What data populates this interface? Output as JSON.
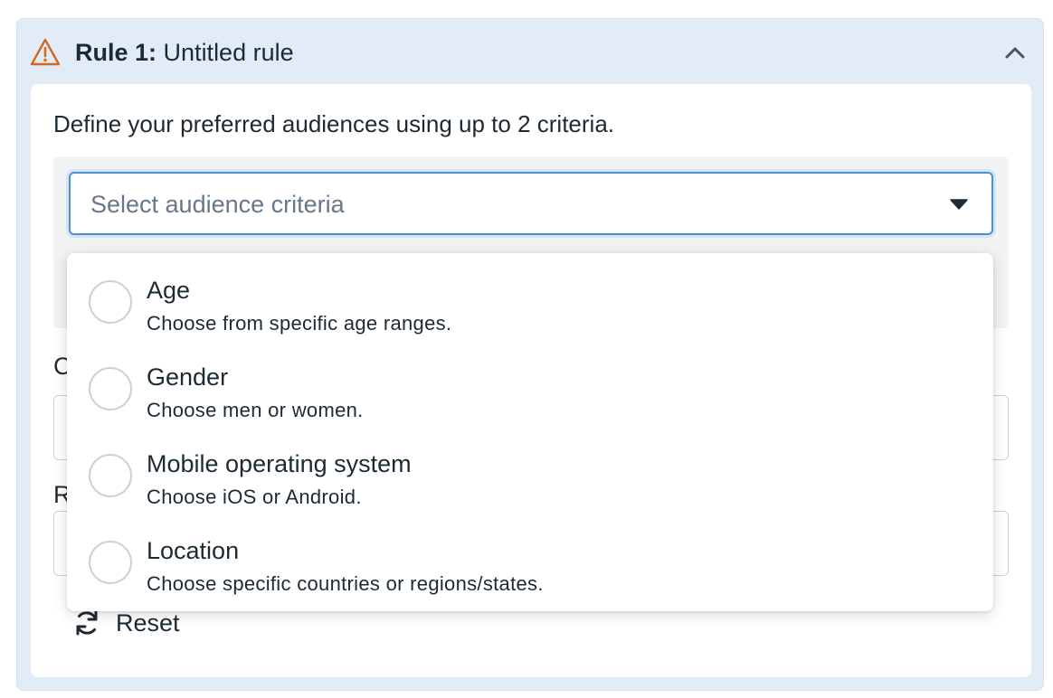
{
  "rule": {
    "prefix": "Rule 1",
    "separator": ":",
    "title": "Untitled rule"
  },
  "intro": "Define your preferred audiences using up to 2 criteria.",
  "select": {
    "placeholder": "Select audience criteria"
  },
  "hidden_fields": {
    "label_1": "C",
    "label_2": "R"
  },
  "reset_label": "Reset",
  "options": [
    {
      "title": "Age",
      "description": "Choose from specific age ranges."
    },
    {
      "title": "Gender",
      "description": "Choose men or women."
    },
    {
      "title": "Mobile operating system",
      "description": "Choose iOS or Android."
    },
    {
      "title": "Location",
      "description": "Choose specific countries or regions/states."
    }
  ],
  "colors": {
    "panel_bg": "#e2ecf6",
    "warning": "#d2691e",
    "focus_border": "#4b8fd6",
    "text": "#1c2b33"
  }
}
